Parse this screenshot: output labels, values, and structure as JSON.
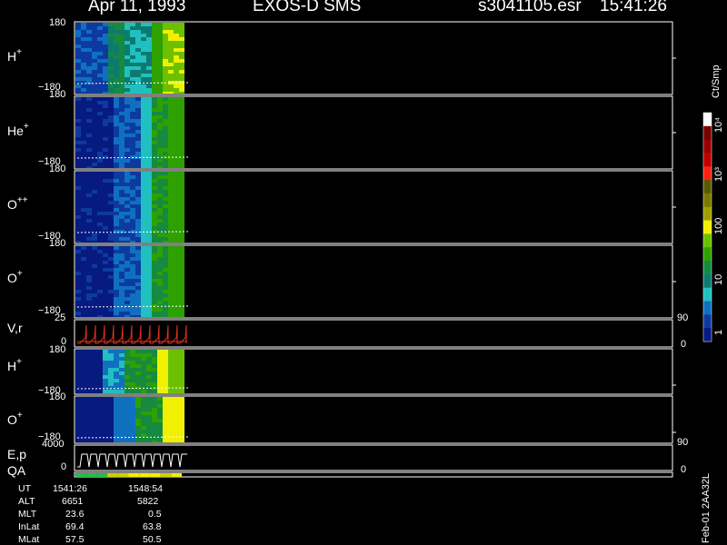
{
  "header": {
    "date": "Apr 11, 1993",
    "instrument": "EXOS-D SMS",
    "file": "s3041105.esr",
    "time": "15:41:26"
  },
  "colors": {
    "background": "#000000",
    "frame": "#ffffff",
    "velocity_trace": "#e03020",
    "trace": "#ffffff"
  },
  "panels": [
    {
      "id": "h-plus",
      "label": "H",
      "sup": "+",
      "top_tick": "180",
      "bottom_tick": "−180",
      "right_tick": ""
    },
    {
      "id": "he-plus",
      "label": "He",
      "sup": "+",
      "top_tick": "180",
      "bottom_tick": "−180",
      "right_tick": ""
    },
    {
      "id": "o-plusplus",
      "label": "O",
      "sup": "++",
      "top_tick": "180",
      "bottom_tick": "−180",
      "right_tick": ""
    },
    {
      "id": "o-plus",
      "label": "O",
      "sup": "+",
      "top_tick": "180",
      "bottom_tick": "−180",
      "right_tick": ""
    },
    {
      "id": "v-r",
      "label": "V,r",
      "sup": "",
      "top_tick": "25",
      "bottom_tick": "0",
      "right_top_tick": "90",
      "right_bottom_tick": "0"
    },
    {
      "id": "h-plus-2",
      "label": "H",
      "sup": "+",
      "top_tick": "180",
      "bottom_tick": "−180",
      "right_tick": ""
    },
    {
      "id": "o-plus-2",
      "label": "O",
      "sup": "+",
      "top_tick": "180",
      "bottom_tick": "−180",
      "right_tick": ""
    },
    {
      "id": "e-p",
      "label": "E,p",
      "sup": "",
      "top_tick": "4000",
      "bottom_tick": "0",
      "right_top_tick": "90",
      "right_bottom_tick": "0"
    },
    {
      "id": "qa",
      "label": "QA",
      "sup": "",
      "top_tick": "",
      "bottom_tick": "",
      "right_tick": ""
    }
  ],
  "colorbar": {
    "title": "Ct/Smp",
    "tick_labels": [
      "10⁴",
      "10³",
      "100",
      "10",
      "1"
    ],
    "colors": [
      "#ffffff",
      "#7a0000",
      "#9a0000",
      "#c00000",
      "#ff2010",
      "#5a5a00",
      "#7a7a00",
      "#a0a000",
      "#f0f000",
      "#6cc000",
      "#2ea000",
      "#158a40",
      "#0d7a70",
      "#20c0c0",
      "#1070c0",
      "#0d3aa0",
      "#071a80"
    ]
  },
  "chart_data": {
    "type": "heatmap",
    "x": {
      "start_ut": "1541:26",
      "end_ut": "1548:54"
    },
    "y_range_pitch": [
      -180,
      180
    ],
    "velocity_range": [
      0,
      25
    ],
    "energy_range": [
      0,
      4000
    ],
    "right_axis_range": [
      0,
      90
    ],
    "colorbar_range_ct_smp": [
      1,
      10000
    ],
    "log_scale_color": true
  },
  "ephemeris": {
    "rows": [
      {
        "name": "UT",
        "v1": "1541:26",
        "v2": "1548:54"
      },
      {
        "name": "ALT",
        "v1": "6651",
        "v2": "5822"
      },
      {
        "name": "MLT",
        "v1": "23.6",
        "v2": "0.5"
      },
      {
        "name": "InLat",
        "v1": "69.4",
        "v2": "63.8"
      },
      {
        "name": "MLat",
        "v1": "57.5",
        "v2": "50.5"
      }
    ]
  },
  "side_text": "Feb-01 2AA32L"
}
